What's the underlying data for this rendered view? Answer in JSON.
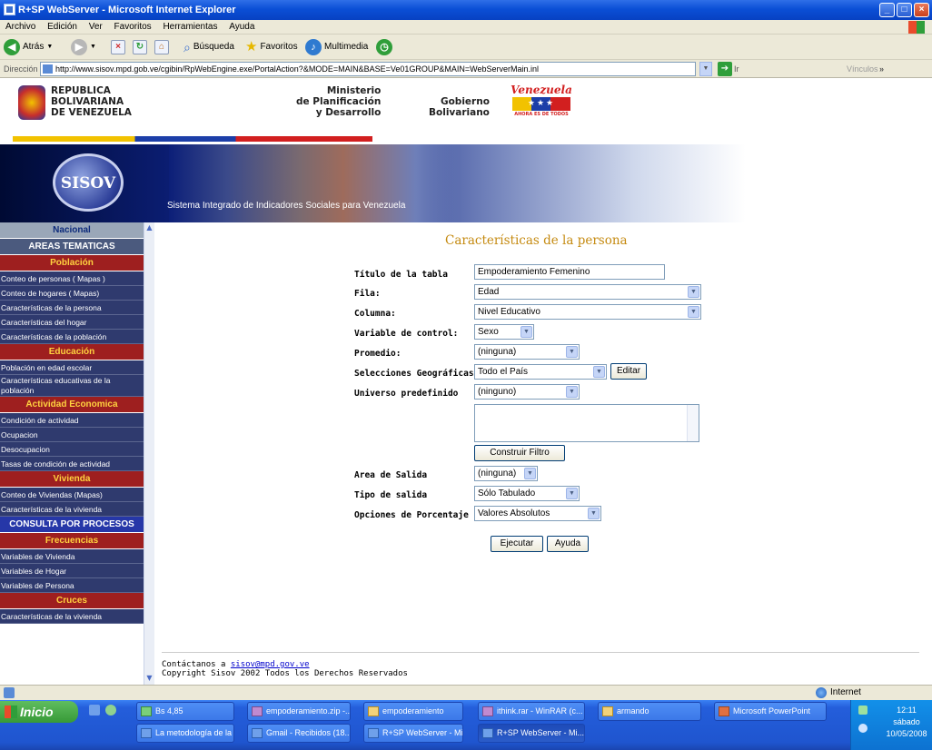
{
  "window": {
    "title": "R+SP WebServer - Microsoft Internet Explorer",
    "controls": {
      "minimize": "_",
      "maximize": "□",
      "close": "×"
    }
  },
  "menu": [
    "Archivo",
    "Edición",
    "Ver",
    "Favoritos",
    "Herramientas",
    "Ayuda"
  ],
  "toolbar": {
    "back": "Atrás",
    "search": "Búsqueda",
    "favorites": "Favoritos",
    "multimedia": "Multimedia"
  },
  "address": {
    "label": "Dirección",
    "url": "http://www.sisov.mpd.gob.ve/cgibin/RpWebEngine.exe/PortalAction?&MODE=MAIN&BASE=Ve01GROUP&MAIN=WebServerMain.inl",
    "go": "Ir",
    "links": "Vínculos",
    "links_more": "»"
  },
  "header": {
    "republic": [
      "REPUBLICA",
      "BOLIVARIANA",
      "DE VENEZUELA"
    ],
    "ministry": [
      "Ministerio",
      "de Planificación",
      "y Desarrollo"
    ],
    "government": [
      "Gobierno",
      "Bolivariano"
    ],
    "venezuela": "Venezuela",
    "venezuela_tag": "AHORA ES DE TODOS",
    "logo": "SISOV",
    "subtitle": "Sistema Integrado de Indicadores Sociales para Venezuela"
  },
  "sidebar": {
    "nacional": "Nacional",
    "areas": "AREAS TEMATICAS",
    "poblacion": "Población",
    "poblacion_items": [
      "Conteo de personas ( Mapas )",
      "Conteo de hogares ( Mapas)",
      "Características de la persona",
      "Características del hogar",
      "Características de la población"
    ],
    "educacion": "Educación",
    "educacion_items": [
      "Población en edad escolar",
      "Características educativas de la población"
    ],
    "actividad": "Actividad Economica",
    "actividad_items": [
      "Condición de actividad",
      "Ocupacion",
      "Desocupacion",
      "Tasas de condición de actividad"
    ],
    "vivienda": "Vivienda",
    "vivienda_items": [
      "Conteo de Viviendas (Mapas)",
      "Características de la vivienda"
    ],
    "consulta": "CONSULTA POR PROCESOS",
    "frecuencias": "Frecuencias",
    "frecuencias_items": [
      "Variables de Vivienda",
      "Variables de Hogar",
      "Variables de Persona"
    ],
    "cruces": "Cruces",
    "cruces_items": [
      "Características de la vivienda"
    ]
  },
  "form": {
    "title": "Características de la persona",
    "labels": {
      "titulo": "Título de la tabla",
      "fila": "Fila:",
      "columna": "Columna:",
      "control": "Variable de control:",
      "promedio": "Promedio:",
      "geo": "Selecciones Geográficas",
      "universo": "Universo predefinido",
      "area": "Area de Salida",
      "tipo": "Tipo de salida",
      "opciones": "Opciones de Porcentaje"
    },
    "values": {
      "titulo": "Empoderamiento Femenino",
      "fila": "Edad",
      "columna": "Nivel Educativo",
      "control": "Sexo",
      "promedio": "(ninguna)",
      "geo": "Todo el País",
      "universo": "(ninguno)",
      "area": "(ninguna)",
      "tipo": "Sólo Tabulado",
      "opciones": "Valores Absolutos"
    },
    "buttons": {
      "editar": "Editar",
      "filtro": "Construir Filtro",
      "ejecutar": "Ejecutar",
      "ayuda": "Ayuda"
    }
  },
  "footer": {
    "contact_prefix": "Contáctanos a ",
    "email": "sisov@mpd.gov.ve",
    "copyright": "Copyright Sisov 2002 Todos los Derechos Reservados"
  },
  "status": {
    "zone": "Internet"
  },
  "taskbar": {
    "start": "Inicio",
    "row1": [
      "Bs 4,85",
      "empoderamiento.zip -...",
      "empoderamiento",
      "ithink.rar - WinRAR (c...",
      "armando",
      "Microsoft PowerPoint"
    ],
    "row2": [
      "La metodología de la ...",
      "Gmail - Recibidos (18...",
      "R+SP WebServer - Mi...",
      "R+SP WebServer - Mi..."
    ],
    "time": "12:11",
    "day": "sábado",
    "date": "10/05/2008"
  },
  "colors": {
    "accent": "#c58a10",
    "sidebar_item": "#2f3a6e",
    "sidebar_category": "#9e1f1f",
    "title_blue": "#0b4fd6"
  },
  "icons": [
    "back-icon",
    "forward-icon",
    "stop-icon",
    "refresh-icon",
    "home-icon",
    "search-icon",
    "favorites-star-icon",
    "multimedia-icon",
    "history-icon",
    "page-icon",
    "go-arrow-icon",
    "dropdown-arrow-icon",
    "globe-icon",
    "windows-logo-icon"
  ]
}
